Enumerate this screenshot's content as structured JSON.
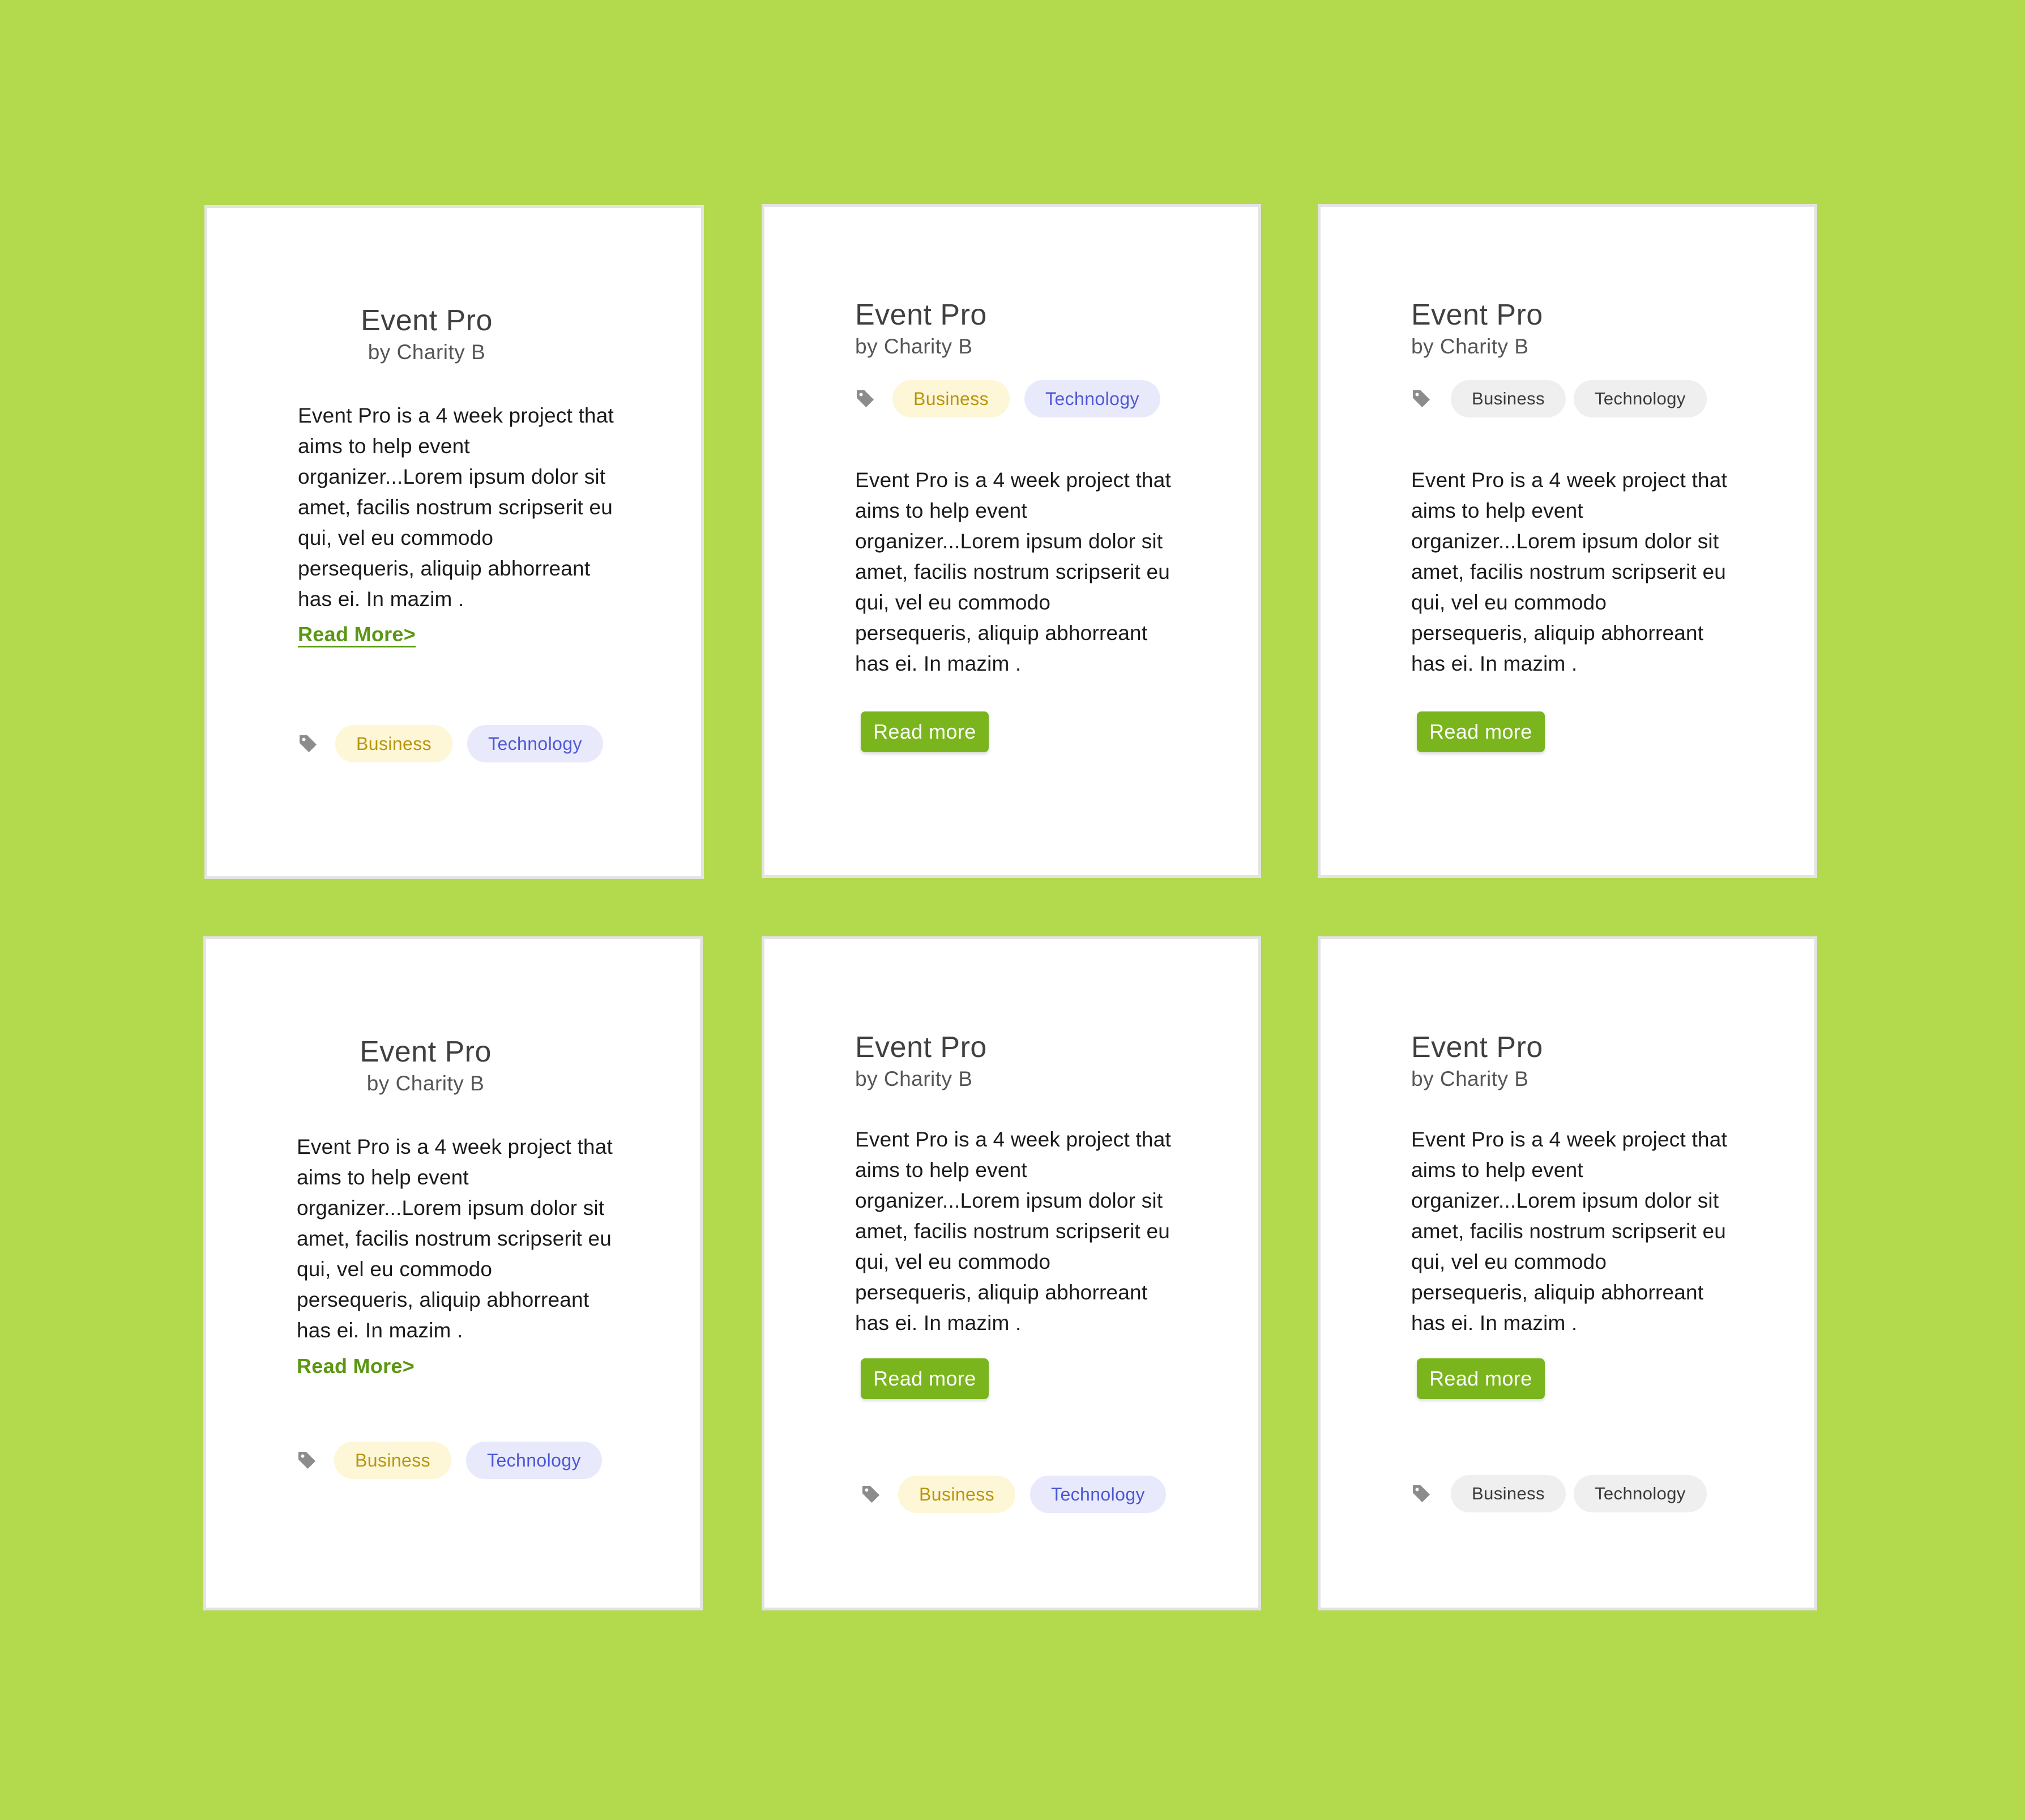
{
  "cards": [
    {
      "title": "Event Pro",
      "author": "by Charity B",
      "description": "Event Pro is a 4 week project that aims to help event organizer...Lorem ipsum dolor sit amet, facilis nostrum scripserit eu qui, vel eu commodo persequeris, aliquip abhorreant has ei. In mazim .",
      "read_more": "Read More>",
      "tags": [
        "Business",
        "Technology"
      ]
    },
    {
      "title": "Event Pro",
      "author": "by Charity B",
      "description": "Event Pro is a 4 week project that aims to help event organizer...Lorem ipsum dolor sit amet, facilis nostrum scripserit eu qui, vel eu commodo persequeris, aliquip abhorreant has ei. In mazim .",
      "read_more": "Read more",
      "tags": [
        "Business",
        "Technology"
      ]
    },
    {
      "title": "Event Pro",
      "author": "by Charity B",
      "description": "Event Pro is a 4 week project that aims to help event organizer...Lorem ipsum dolor sit amet, facilis nostrum scripserit eu qui, vel eu commodo persequeris, aliquip abhorreant has ei. In mazim .",
      "read_more": "Read more",
      "tags": [
        "Business",
        "Technology"
      ]
    },
    {
      "title": "Event Pro",
      "author": "by Charity B",
      "description": "Event Pro is a 4 week project that aims to help event organizer...Lorem ipsum dolor sit amet, facilis nostrum scripserit eu qui, vel eu commodo persequeris, aliquip abhorreant has ei. In mazim .",
      "read_more": "Read More>",
      "tags": [
        "Business",
        "Technology"
      ]
    },
    {
      "title": "Event Pro",
      "author": "by Charity B",
      "description": "Event Pro is a 4 week project that aims to help event organizer...Lorem ipsum dolor sit amet, facilis nostrum scripserit eu qui, vel eu commodo persequeris, aliquip abhorreant has ei. In mazim .",
      "read_more": "Read more",
      "tags": [
        "Business",
        "Technology"
      ]
    },
    {
      "title": "Event Pro",
      "author": "by Charity B",
      "description": "Event Pro is a 4 week project that aims to help event organizer...Lorem ipsum dolor sit amet, facilis nostrum scripserit eu qui, vel eu commodo persequeris, aliquip abhorreant has ei. In mazim .",
      "read_more": "Read more",
      "tags": [
        "Business",
        "Technology"
      ]
    }
  ],
  "colors": {
    "background": "#b3d94d",
    "accent": "#7ab51d",
    "link": "#5b9712",
    "business_tag": "#b8960c",
    "technology_tag": "#4e57d6"
  },
  "icons": {
    "tag": "tag-icon"
  }
}
